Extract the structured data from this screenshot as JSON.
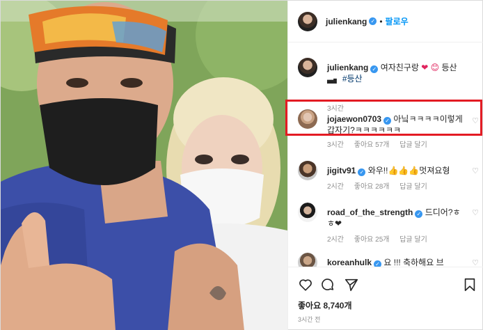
{
  "header": {
    "username": "julienkang",
    "separator": "•",
    "follow_label": "팔로우"
  },
  "comments": [
    {
      "username": "julienkang",
      "text": "여자친구랑",
      "emoji": "❤ 😊",
      "text2": "등산",
      "hashtag": "#등산",
      "time": "3시간"
    },
    {
      "username": "jojaewon0703",
      "text": "아닠ㅋㅋㅋㅋ이렇게 갑자기?ㅋㅋㅋㅋㅋㅋ",
      "time": "3시간",
      "likes": "좋아요 57개",
      "reply": "답글 달기"
    },
    {
      "username": "jigitv91",
      "text": "와우!!👍👍👍멋져요형",
      "time": "2시간",
      "likes": "좋아요 28개",
      "reply": "답글 달기"
    },
    {
      "username": "road_of_the_strength",
      "text": "드디어?ㅎㅎ❤",
      "time": "2시간",
      "likes": "좋아요 25개",
      "reply": "답글 달기"
    },
    {
      "username": "koreanhulk",
      "text": "요 !!! 축하해요 브"
    }
  ],
  "footer": {
    "likes_text": "좋아요 8,740개",
    "time_ago": "3시간 전"
  },
  "icons": {
    "heart": "heart-icon",
    "comment": "comment-icon",
    "share": "share-icon",
    "save": "bookmark-icon"
  },
  "colors": {
    "accent": "#0095f6",
    "highlight": "#e31b23"
  }
}
